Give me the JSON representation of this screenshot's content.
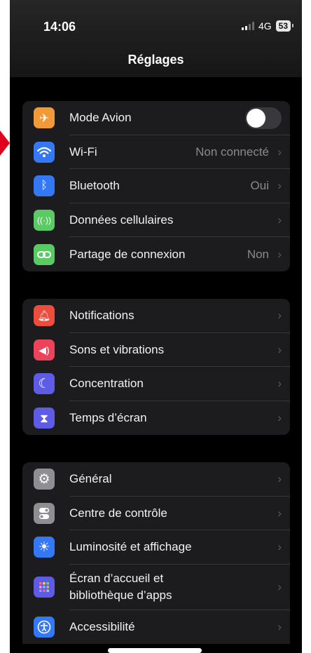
{
  "status": {
    "time": "14:06",
    "network": "4G",
    "battery": "53"
  },
  "nav": {
    "title": "Réglages"
  },
  "groups": [
    {
      "items": [
        {
          "label": "Mode Avion",
          "icon": "airplane-icon",
          "color": "#F19A37",
          "control": "toggle",
          "on": false
        },
        {
          "label": "Wi-Fi",
          "icon": "wifi-icon",
          "color": "#3478F6",
          "value": "Non connecté"
        },
        {
          "label": "Bluetooth",
          "icon": "bluetooth-icon",
          "color": "#3478F6",
          "value": "Oui"
        },
        {
          "label": "Données cellulaires",
          "icon": "cellular-icon",
          "color": "#5ACB64"
        },
        {
          "label": "Partage de connexion",
          "icon": "hotspot-icon",
          "color": "#5ACB64",
          "value": "Non"
        }
      ]
    },
    {
      "items": [
        {
          "label": "Notifications",
          "icon": "notifications-icon",
          "color": "#EB4E3D"
        },
        {
          "label": "Sons et vibrations",
          "icon": "sound-icon",
          "color": "#EB445A"
        },
        {
          "label": "Concentration",
          "icon": "moon-icon",
          "color": "#5E5CE6"
        },
        {
          "label": "Temps d’écran",
          "icon": "hourglass-icon",
          "color": "#5E5CE6"
        }
      ]
    },
    {
      "items": [
        {
          "label": "Général",
          "icon": "gear-icon",
          "color": "#8E8E93"
        },
        {
          "label": "Centre de contrôle",
          "icon": "control-center-icon",
          "color": "#8E8E93"
        },
        {
          "label": "Luminosité et affichage",
          "icon": "brightness-icon",
          "color": "#3478F6"
        },
        {
          "label_line1": "Écran d’accueil et",
          "label_line2": "bibliothèque d’apps",
          "icon": "home-screen-icon",
          "color": "#5E5CE6"
        },
        {
          "label": "Accessibilité",
          "icon": "accessibility-icon",
          "color": "#3478F6"
        }
      ]
    }
  ],
  "chevron": "›",
  "toggle_knob_color": "#FFFFFF",
  "annotation_arrow_color": "#E0001B"
}
